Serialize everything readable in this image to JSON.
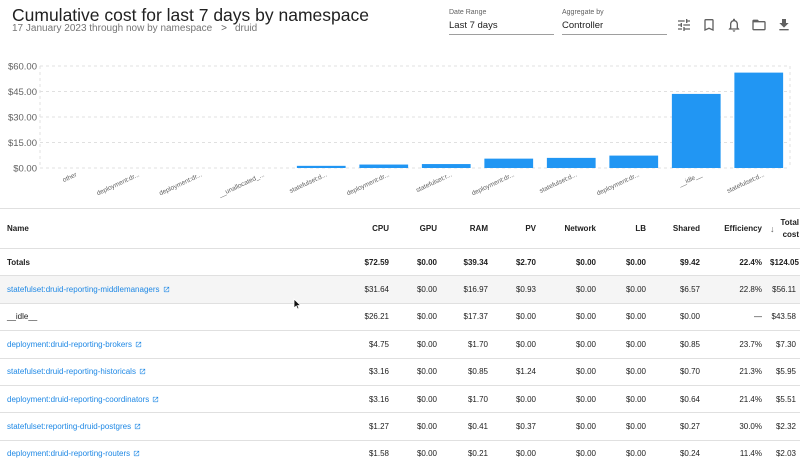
{
  "header": {
    "title": "Cumulative cost for last 7 days by namespace",
    "subtitle_range": "17 January 2023 through now by namespace",
    "breadcrumb_separator": ">",
    "breadcrumb_item": "druid"
  },
  "filters": {
    "date_range": {
      "label": "Date Range",
      "value": "Last 7 days"
    },
    "aggregate_by": {
      "label": "Aggregate by",
      "value": "Controller"
    }
  },
  "toolbar": {
    "icons": [
      "tune-icon",
      "bookmark-icon",
      "bell-icon",
      "folder-icon",
      "download-icon"
    ]
  },
  "chart_data": {
    "type": "bar",
    "color": "#2196f3",
    "ylim": [
      0,
      60
    ],
    "yticks": [
      "$0.00",
      "$15.00",
      "$30.00",
      "$45.00",
      "$60.00"
    ],
    "ytick_values": [
      0,
      15,
      30,
      45,
      60
    ],
    "grid": true,
    "categories": [
      "other",
      "deployment:dr...",
      "deployment:dr...",
      "__unallocated_...",
      "statefulset:d...",
      "deployment:dr...",
      "statefulset:r...",
      "deployment:dr...",
      "statefulset:d...",
      "deployment:dr...",
      "__idle__",
      "statefulset:d..."
    ],
    "values": [
      0,
      0,
      0,
      0,
      1.27,
      2.03,
      2.32,
      5.51,
      5.95,
      7.3,
      43.58,
      56.11
    ]
  },
  "table": {
    "columns": [
      "Name",
      "CPU",
      "GPU",
      "RAM",
      "PV",
      "Network",
      "LB",
      "Shared",
      "Efficiency",
      "Total",
      "cost"
    ],
    "sort_icon": "↓",
    "totals": {
      "name": "Totals",
      "cells": [
        "$72.59",
        "$0.00",
        "$39.34",
        "$2.70",
        "$0.00",
        "$0.00",
        "$9.42",
        "22.4%",
        "$124.05"
      ]
    },
    "rows": [
      {
        "name": "statefulset:druid-reporting-middlemanagers",
        "cells": [
          "$31.64",
          "$0.00",
          "$16.97",
          "$0.93",
          "$0.00",
          "$0.00",
          "$6.57",
          "22.8%",
          "$56.11"
        ]
      },
      {
        "name": "__idle__",
        "cells": [
          "$26.21",
          "$0.00",
          "$17.37",
          "$0.00",
          "$0.00",
          "$0.00",
          "$0.00",
          "—",
          "$43.58"
        ]
      },
      {
        "name": "deployment:druid-reporting-brokers",
        "cells": [
          "$4.75",
          "$0.00",
          "$1.70",
          "$0.00",
          "$0.00",
          "$0.00",
          "$0.85",
          "23.7%",
          "$7.30"
        ]
      },
      {
        "name": "statefulset:druid-reporting-historicals",
        "cells": [
          "$3.16",
          "$0.00",
          "$0.85",
          "$1.24",
          "$0.00",
          "$0.00",
          "$0.70",
          "21.3%",
          "$5.95"
        ]
      },
      {
        "name": "deployment:druid-reporting-coordinators",
        "cells": [
          "$3.16",
          "$0.00",
          "$1.70",
          "$0.00",
          "$0.00",
          "$0.00",
          "$0.64",
          "21.4%",
          "$5.51"
        ]
      },
      {
        "name": "statefulset:reporting-druid-postgres",
        "cells": [
          "$1.27",
          "$0.00",
          "$0.41",
          "$0.37",
          "$0.00",
          "$0.00",
          "$0.27",
          "30.0%",
          "$2.32"
        ]
      },
      {
        "name": "deployment:druid-reporting-routers",
        "cells": [
          "$1.58",
          "$0.00",
          "$0.21",
          "$0.00",
          "$0.00",
          "$0.00",
          "$0.24",
          "11.4%",
          "$2.03"
        ]
      }
    ]
  }
}
